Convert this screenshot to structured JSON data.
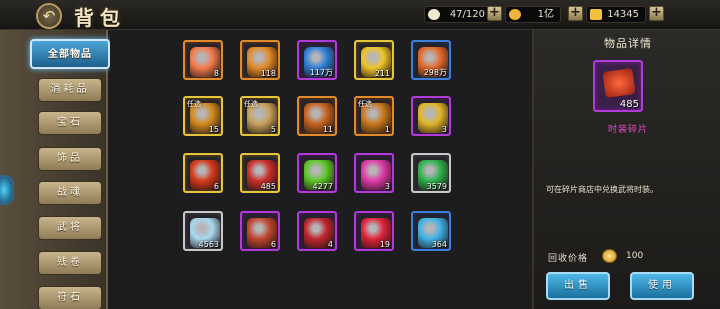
{
  "header": {
    "title": "背包",
    "back_icon": "back-arrow-icon"
  },
  "resources": [
    {
      "name": "stamina",
      "value": "47/120",
      "icon": "rice-bun-icon",
      "color": "#f2ead0"
    },
    {
      "name": "coins",
      "value": "1亿",
      "icon": "gold-coin-icon",
      "color": "#f0b43a"
    },
    {
      "name": "ingots",
      "value": "14345",
      "icon": "gold-ingot-icon",
      "color": "#f3c13c"
    }
  ],
  "tabs": [
    {
      "label": "全部物品",
      "active": true
    },
    {
      "label": "消耗品"
    },
    {
      "label": "宝石"
    },
    {
      "label": "饰品"
    },
    {
      "label": "战魂"
    },
    {
      "label": "武将"
    },
    {
      "label": "残卷"
    },
    {
      "label": "符石"
    }
  ],
  "items": [
    {
      "qty": "8",
      "border": "orange",
      "icon": "gem-crystal-icon",
      "color": "#f47b4a"
    },
    {
      "qty": "118",
      "border": "orange",
      "icon": "peach-fruit-icon",
      "color": "#e28a28"
    },
    {
      "qty": "117万",
      "border": "purple",
      "icon": "blue-flame-orb-icon",
      "color": "#2f7fd8"
    },
    {
      "qty": "211",
      "border": "gold",
      "icon": "gold-coin-icon",
      "color": "#f0c528"
    },
    {
      "qty": "298万",
      "border": "blue",
      "icon": "treasure-box-icon",
      "color": "#e46a2a"
    },
    {
      "qty": "15",
      "border": "gold",
      "icon": "treasure-chest-icon",
      "color": "#d48a1e",
      "tag": "任选"
    },
    {
      "qty": "5",
      "border": "gold",
      "icon": "treasure-chest-icon",
      "color": "#c8a25a",
      "tag": "任选"
    },
    {
      "qty": "11",
      "border": "orange",
      "icon": "treasure-chest-icon",
      "color": "#c7641f"
    },
    {
      "qty": "1",
      "border": "orange",
      "icon": "treasure-chest-icon",
      "color": "#c9791c",
      "tag": "任选"
    },
    {
      "qty": "3",
      "border": "purple",
      "icon": "gold-ingots-icon",
      "color": "#e2b62a"
    },
    {
      "qty": "6",
      "border": "gold",
      "icon": "lucky-bag-icon",
      "color": "#d43a1a"
    },
    {
      "qty": "485",
      "border": "gold",
      "icon": "costume-fragment-icon",
      "color": "#c9302a"
    },
    {
      "qty": "4277",
      "border": "purple",
      "icon": "green-jade-orb-icon",
      "color": "#5ec62a"
    },
    {
      "qty": "3",
      "border": "purple",
      "icon": "magic-orb-icon",
      "color": "#e03aa8"
    },
    {
      "qty": "3579",
      "border": "white",
      "icon": "emerald-gem-icon",
      "color": "#2fb34c"
    },
    {
      "qty": "4563",
      "border": "white",
      "icon": "ice-crystal-icon",
      "color": "#a8d8f0"
    },
    {
      "qty": "6",
      "border": "purple",
      "icon": "fragment-scroll-icon",
      "color": "#c0462e"
    },
    {
      "qty": "4",
      "border": "purple",
      "icon": "red-pouch-icon",
      "color": "#c0262e"
    },
    {
      "qty": "19",
      "border": "purple",
      "icon": "protection-card-icon",
      "color": "#e0243c"
    },
    {
      "qty": "364",
      "border": "blue",
      "icon": "blue-crystal-icon",
      "color": "#3fb3e8"
    }
  ],
  "detail": {
    "title": "物品详情",
    "item_qty": "485",
    "item_name": "时装碎片",
    "description": "可在碎片商店中兑换武将时装。",
    "price_label": "回收价格",
    "price_value": "100",
    "sell_label": "出售",
    "use_label": "使用"
  }
}
